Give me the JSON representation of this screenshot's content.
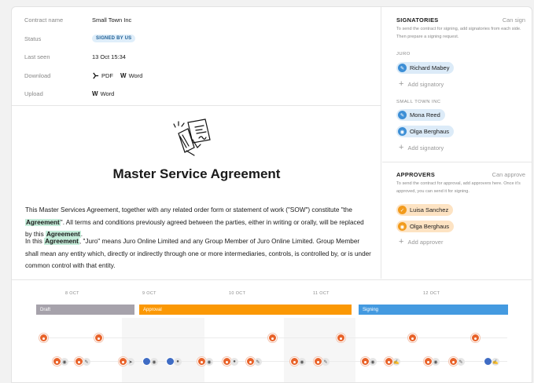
{
  "meta": {
    "rows": [
      {
        "key": "Contract name",
        "value": "Small Town Inc"
      },
      {
        "key": "Status",
        "value": "SIGNED BY US"
      },
      {
        "key": "Last seen",
        "value": "13 Oct 15:34"
      },
      {
        "key": "Download",
        "value": ""
      },
      {
        "key": "Upload",
        "value": ""
      }
    ],
    "download": [
      {
        "icon": "pdf-icon",
        "label": "PDF"
      },
      {
        "icon": "word-icon",
        "label": "Word"
      }
    ],
    "upload": [
      {
        "icon": "word-icon",
        "label": "Word"
      }
    ]
  },
  "document": {
    "title": "Master Service Agreement",
    "para1": {
      "t1": "This Master Services Agreement, together with any related order form or statement of work (\"SOW\") constitute \"the ",
      "h1": "Agreement",
      "t2": "\". All terms and conditions previously agreed between the parties, either in writing or orally, will be replaced by this ",
      "h2": "Agreement",
      "t3": "."
    },
    "para2": {
      "t1": "In this ",
      "h1": "Agreement",
      "t2": ", \"Juro\" means Juro Online Limited and any Group Member of Juro Online Limited. Group Member shall mean any entity which, directly or indirectly through one or more intermediaries, controls, is controlled by, or is under common control with that entity."
    }
  },
  "signatories": {
    "title": "SIGNATORIES",
    "status": "Can sign",
    "hint": "To send the contract for signing, add signatories from each side. Then prepare a signing request.",
    "groups": [
      {
        "name": "JURO",
        "people": [
          "Richard Mabey"
        ],
        "add_label": "Add signatory"
      },
      {
        "name": "SMALL TOWN INC",
        "people": [
          "Mona Reed",
          "Olga Berghaus"
        ],
        "add_label": "Add signatory"
      }
    ]
  },
  "approvers": {
    "title": "APPROVERS",
    "status": "Can approve",
    "hint": "To send the contract for approval, add approvers here. Once it's approved, you can send it for signing.",
    "people": [
      "Luisa Sanchez",
      "Olga Berghaus"
    ],
    "add_label": "Add approver"
  },
  "timeline": {
    "ticks": [
      "8 OCT",
      "9 OCT",
      "10 OCT",
      "11 OCT",
      "12 OCT"
    ],
    "phases": [
      {
        "label": "Draft",
        "color": "#a6a2ab"
      },
      {
        "label": "Approval",
        "color": "#fb9804"
      },
      {
        "label": "Signing",
        "color": "#449ae0"
      }
    ]
  },
  "colors": {
    "highlight": "#c4ecd9",
    "fox": "#e8632a"
  }
}
